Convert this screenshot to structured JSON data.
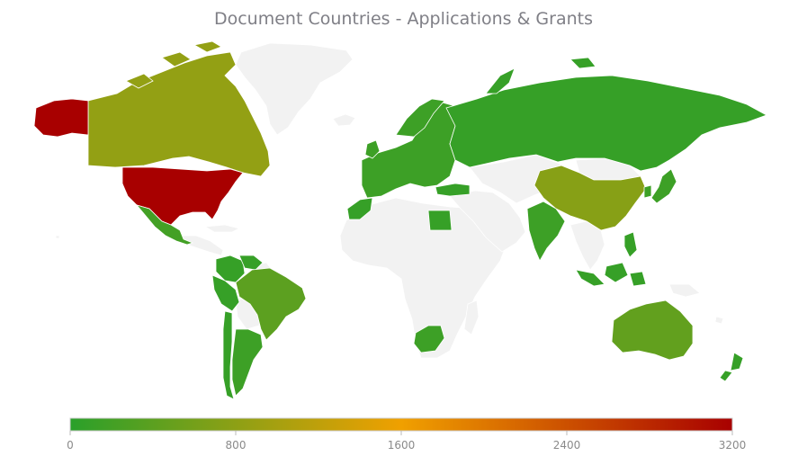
{
  "title": "Document Countries - Applications & Grants",
  "colors": {
    "no_data": "#f2f2f2",
    "border": "#ffffff",
    "scale_low": "#2aa02a",
    "scale_mid": "#f0a000",
    "scale_high": "#a80000"
  },
  "color_scale": {
    "min": 0,
    "max": 3200,
    "ticks": [
      "0",
      "800",
      "1600",
      "2400",
      "3200"
    ]
  },
  "countries": [
    {
      "name": "United States",
      "level": 3200
    },
    {
      "name": "Alaska (US)",
      "level": 3200
    },
    {
      "name": "Canada",
      "level": 850
    },
    {
      "name": "Mexico",
      "level": 200
    },
    {
      "name": "Brazil",
      "level": 400
    },
    {
      "name": "Argentina",
      "level": 150
    },
    {
      "name": "Chile",
      "level": 100
    },
    {
      "name": "Colombia",
      "level": 100
    },
    {
      "name": "Peru",
      "level": 100
    },
    {
      "name": "Venezuela",
      "level": 100
    },
    {
      "name": "Russia",
      "level": 100
    },
    {
      "name": "China",
      "level": 750
    },
    {
      "name": "India",
      "level": 150
    },
    {
      "name": "Japan",
      "level": 150
    },
    {
      "name": "South Korea",
      "level": 150
    },
    {
      "name": "Australia",
      "level": 450
    },
    {
      "name": "New Zealand",
      "level": 100
    },
    {
      "name": "South Africa",
      "level": 150
    },
    {
      "name": "Egypt",
      "level": 100
    },
    {
      "name": "Morocco",
      "level": 100
    },
    {
      "name": "Europe",
      "level": 150
    },
    {
      "name": "Turkey",
      "level": 100
    },
    {
      "name": "Indonesia",
      "level": 100
    },
    {
      "name": "Greenland",
      "level": null
    }
  ]
}
